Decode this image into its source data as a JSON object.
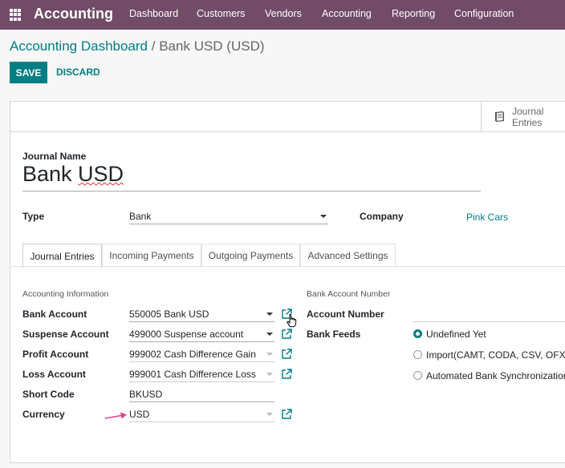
{
  "app": {
    "name": "Accounting",
    "nav": [
      "Dashboard",
      "Customers",
      "Vendors",
      "Accounting",
      "Reporting",
      "Configuration"
    ]
  },
  "breadcrumb": {
    "parent": "Accounting Dashboard",
    "separator": "/",
    "current": "Bank USD (USD)"
  },
  "actions": {
    "save": "SAVE",
    "discard": "DISCARD"
  },
  "smart_button": {
    "icon": "book-icon",
    "label": "Journal Entries"
  },
  "form": {
    "journal_name_label": "Journal Name",
    "journal_name_prefix": "Bank ",
    "journal_name_suffix": "USD",
    "type_label": "Type",
    "type_value": "Bank",
    "company_label": "Company",
    "company_value": "Pink Cars"
  },
  "tabs": [
    {
      "label": "Journal Entries",
      "active": true
    },
    {
      "label": "Incoming Payments",
      "active": false
    },
    {
      "label": "Outgoing Payments",
      "active": false
    },
    {
      "label": "Advanced Settings",
      "active": false
    }
  ],
  "accounting_info": {
    "title": "Accounting Information",
    "fields": [
      {
        "label": "Bank Account",
        "value": "550005 Bank USD"
      },
      {
        "label": "Suspense Account",
        "value": "499000 Suspense account"
      },
      {
        "label": "Profit Account",
        "value": "999002 Cash Difference Gain"
      },
      {
        "label": "Loss Account",
        "value": "999001 Cash Difference Loss"
      },
      {
        "label": "Short Code",
        "value": "BKUSD"
      },
      {
        "label": "Currency",
        "value": "USD"
      }
    ]
  },
  "bank_account": {
    "title": "Bank Account Number",
    "account_number_label": "Account Number",
    "account_number_value": "",
    "feeds_label": "Bank Feeds",
    "feeds_options": [
      {
        "label": "Undefined Yet",
        "checked": true
      },
      {
        "label": "Import(CAMT, CODA, CSV, OFX)",
        "checked": false
      },
      {
        "label": "Automated Bank Synchronization",
        "checked": false
      }
    ]
  },
  "colors": {
    "topbar": "#714b67",
    "accent": "#017e84",
    "annotation_arrow": "#e83e8c"
  }
}
